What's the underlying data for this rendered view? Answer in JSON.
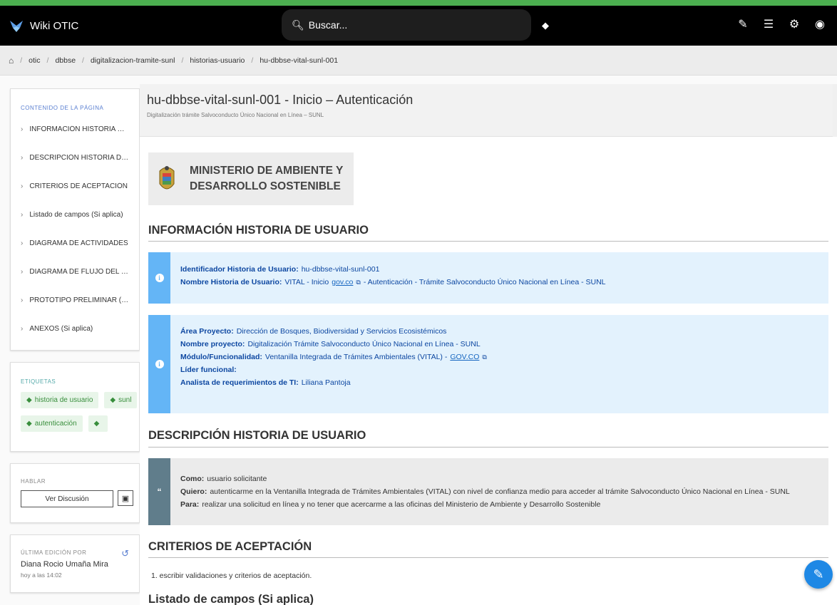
{
  "app": {
    "title": "Wiki OTIC"
  },
  "search": {
    "placeholder": "Buscar..."
  },
  "breadcrumb": [
    "otic",
    "dbbse",
    "digitalizacion-tramite-sunl",
    "historias-usuario",
    "hu-dbbse-vital-sunl-001"
  ],
  "toc": {
    "heading": "CONTENIDO DE LA PÁGINA",
    "items": [
      "INFORMACIÓN HISTORIA DE USUA...",
      "DESCRIPCIÓN HISTORIA DE USUAR...",
      "CRITERIOS DE ACEPTACIÓN",
      "Listado de campos (Si aplica)",
      "DIAGRAMA DE ACTIVIDADES",
      "DIAGRAMA DE FLUJO DEL PROCES...",
      "PROTOTIPO PRELIMINAR (Si aplica)",
      "ANEXOS (Si aplica)"
    ]
  },
  "tags": {
    "heading": "ETIQUETAS",
    "items": [
      "historia de usuario",
      "sunl",
      "autenticación",
      ""
    ]
  },
  "talk": {
    "heading": "HABLAR",
    "button_label": "Ver Discusión"
  },
  "last_edit": {
    "heading": "ÚLTIMA EDICIÓN POR",
    "name": "Diana Rocio Umaña Mira",
    "when": "hoy a las 14:02"
  },
  "page": {
    "title": "hu-dbbse-vital-sunl-001 - Inicio – Autenticación",
    "subtitle": "Digitalización trámite Salvoconducto Único Nacional en Línea – SUNL"
  },
  "ministry": {
    "line1": "MINISTERIO DE AMBIENTE Y",
    "line2": "DESARROLLO SOSTENIBLE"
  },
  "sections": {
    "info": "INFORMACIÓN HISTORIA DE USUARIO",
    "desc": "DESCRIPCIÓN HISTORIA DE USUARIO",
    "criteria": "CRITERIOS DE ACEPTACIÓN",
    "fields": "Listado de campos (Si aplica)"
  },
  "info_box1": {
    "id_label": "Identificador Historia de Usuario:",
    "id_value": "hu-dbbse-vital-sunl-001",
    "name_label": "Nombre Historia de Usuario:",
    "name_value_pre": "VITAL - Inicio",
    "name_link": "gov.co",
    "name_value_post": "- Autenticación - Trámite Salvoconducto Único Nacional en Línea - SUNL"
  },
  "info_box2": {
    "area_label": "Área Proyecto:",
    "area_value": "Dirección de Bosques, Biodiversidad y Servicios Ecosistémicos",
    "project_label": "Nombre proyecto:",
    "project_value": "Digitalización Trámite Salvoconducto Único Nacional en Línea - SUNL",
    "module_label": "Módulo/Funcionalidad:",
    "module_value": "Ventanilla Integrada de Trámites Ambientales (VITAL) -",
    "module_link": "GOV.CO",
    "leader_label": "Líder funcional:",
    "analyst_label": "Analista de requerimientos de TI:",
    "analyst_value": "Liliana Pantoja"
  },
  "quote": {
    "como_label": "Como:",
    "como_value": "usuario solicitante",
    "quiero_label": "Quiero:",
    "quiero_value": "autenticarme en la Ventanilla Integrada de Trámites Ambientales (VITAL) con nivel de confianza medio para acceder al trámite Salvoconducto Único Nacional en Línea - SUNL",
    "para_label": "Para:",
    "para_value": "realizar una solicitud en línea y no tener que acercarme a las oficinas del Ministerio de Ambiente y Desarrollo Sostenible"
  },
  "criteria_item": "1. escribir validaciones y criterios de aceptación.",
  "colors": {
    "appbar": "#000000",
    "accent": "#1e88e5",
    "callout_bg": "#e3f2fd",
    "callout_bar": "#64b5f6",
    "quote_bar": "#607d8b",
    "chip_text": "#388e3c"
  }
}
